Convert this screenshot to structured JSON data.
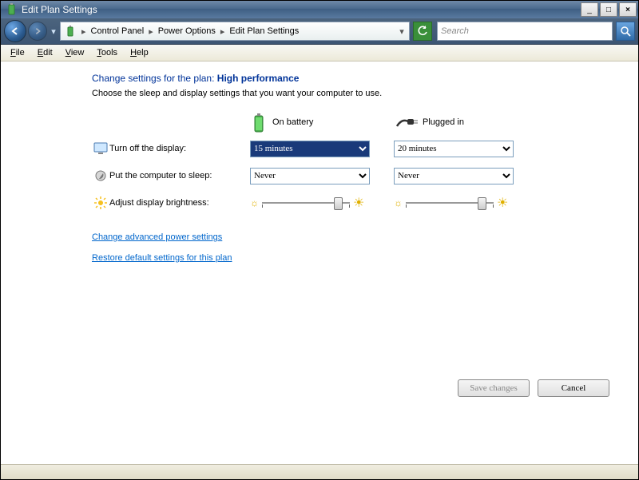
{
  "titlebar": {
    "title": "Edit Plan Settings"
  },
  "breadcrumb": {
    "items": [
      "Control Panel",
      "Power Options",
      "Edit Plan Settings"
    ]
  },
  "search": {
    "placeholder": "Search"
  },
  "menu": {
    "file": "File",
    "edit": "Edit",
    "view": "View",
    "tools": "Tools",
    "help": "Help"
  },
  "page": {
    "heading_prefix": "Change settings for the plan: ",
    "plan_name": "High performance",
    "sub": "Choose the sleep and display settings that you want your computer to use.",
    "col_battery": "On battery",
    "col_plugged": "Plugged in",
    "row_display": "Turn off the display:",
    "row_sleep": "Put the computer to sleep:",
    "row_brightness": "Adjust display brightness:",
    "display_battery_value": "15 minutes",
    "display_plugged_value": "20 minutes",
    "sleep_battery_value": "Never",
    "sleep_plugged_value": "Never",
    "brightness_battery_pct": 90,
    "brightness_plugged_pct": 90,
    "link_advanced": "Change advanced power settings",
    "link_restore": "Restore default settings for this plan",
    "btn_save": "Save changes",
    "btn_cancel": "Cancel"
  }
}
